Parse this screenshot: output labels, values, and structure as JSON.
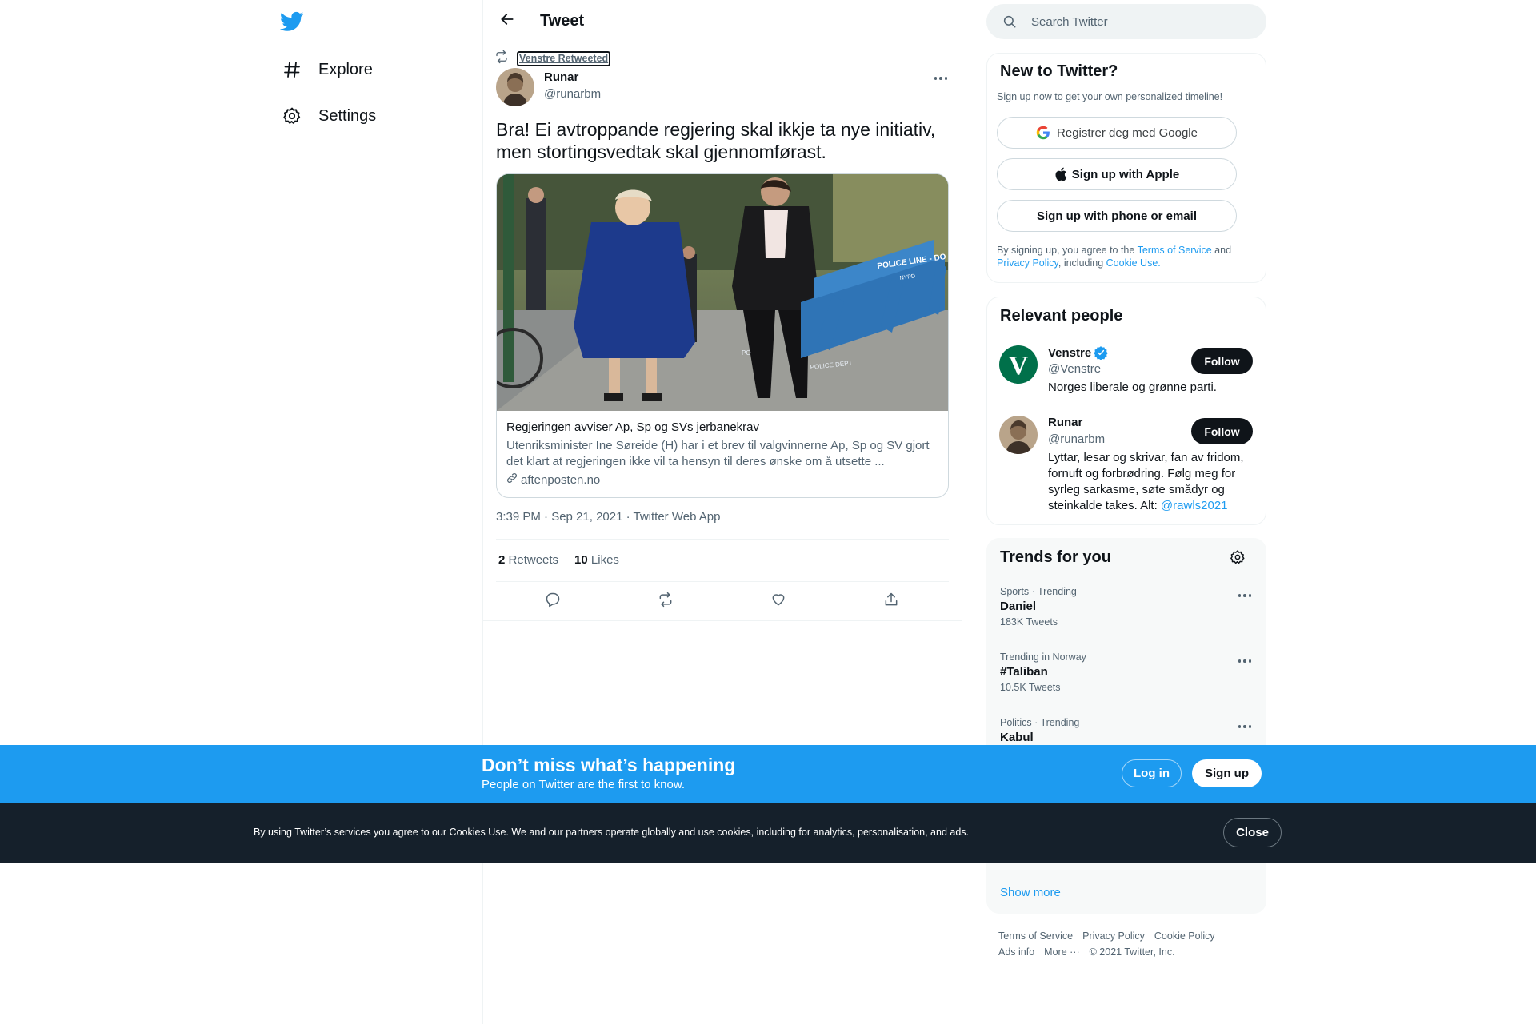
{
  "nav": {
    "items": [
      {
        "label": "Explore",
        "icon": "hashtag-icon"
      },
      {
        "label": "Settings",
        "icon": "gear-icon"
      }
    ]
  },
  "header": {
    "title": "Tweet"
  },
  "tweet": {
    "retweeted_by": "Venstre Retweeted",
    "author_name": "Runar",
    "author_handle": "@runarbm",
    "text": "Bra! Ei avtroppande regjering skal ikkje ta nye initiativ, men stortingsvedtak skal gjennomførast.",
    "card": {
      "title": "Regjeringen avviser Ap, Sp og SVs jerbanekrav",
      "description": "Utenriksminister Ine Søreide (H) har i et brev til valgvinnerne Ap, Sp og SV gjort det klart at regjeringen ikke vil ta hensyn til deres ønske om å utsette ...",
      "domain": "aftenposten.no",
      "image_signs": [
        "POLICE LINE - DO NOT CROSS",
        "NYPD",
        "POLICE DEPT",
        "PO"
      ]
    },
    "meta": "3:39 PM · Sep 21, 2021 · Twitter Web App",
    "retweets_count": "2",
    "retweets_label": "Retweets",
    "likes_count": "10",
    "likes_label": "Likes"
  },
  "search": {
    "placeholder": "Search Twitter"
  },
  "signup_panel": {
    "title": "New to Twitter?",
    "subtitle": "Sign up now to get your own personalized timeline!",
    "google_label": "Registrer deg med Google",
    "apple_label": "Sign up with Apple",
    "phone_label": "Sign up with phone or email",
    "legal_prefix": "By signing up, you agree to the",
    "terms": "Terms of Service",
    "and": "and",
    "privacy": "Privacy Policy",
    "including": ", including",
    "cookie_use": "Cookie Use."
  },
  "relevant": {
    "title": "Relevant people",
    "people": [
      {
        "name": "Venstre",
        "handle": "@Venstre",
        "bio": "Norges liberale og grønne parti.",
        "follow": "Follow",
        "avatar_letter": "V"
      },
      {
        "name": "Runar",
        "handle": "@runarbm",
        "bio": "Lyttar, lesar og skrivar, fan av fridom, fornuft og forbrødring. Følg meg for syrleg sarkasme, søte smådyr og steinkalde takes. Alt:",
        "bio_link": "@rawls2021",
        "follow": "Follow"
      }
    ]
  },
  "trends": {
    "title": "Trends for you",
    "items": [
      {
        "meta": "Sports · Trending",
        "name": "Daniel",
        "count": "183K Tweets"
      },
      {
        "meta": "Trending in Norway",
        "name": "#Taliban",
        "count": "10.5K Tweets"
      },
      {
        "meta": "Politics · Trending",
        "name": "Kabul",
        "count": ""
      }
    ],
    "show_more": "Show more"
  },
  "footer": {
    "row1": [
      "Terms of Service",
      "Privacy Policy",
      "Cookie Policy"
    ],
    "row2": [
      "Ads info",
      "More ···",
      "© 2021 Twitter, Inc."
    ]
  },
  "bottom_bar": {
    "title": "Don’t miss what’s happening",
    "subtitle": "People on Twitter are the first to know.",
    "login": "Log in",
    "signup": "Sign up"
  },
  "cookie_bar": {
    "text": "By using Twitter’s services you agree to our Cookies Use. We and our partners operate globally and use cookies, including for analytics, personalisation, and ads.",
    "close": "Close"
  },
  "colors": {
    "accent": "#1d9bf0",
    "text": "#0f1419",
    "secondary": "#536471",
    "cookie_bg": "#15202b"
  }
}
